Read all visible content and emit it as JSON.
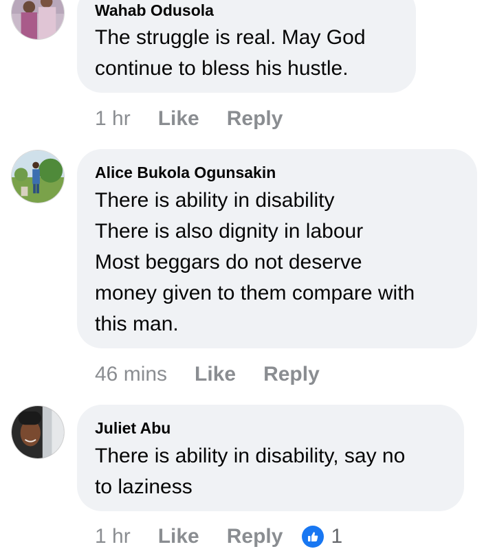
{
  "comments": [
    {
      "author": "Wahab Odusola",
      "text": "The struggle is real. May God\ncontinue to bless his hustle.",
      "time": "1 hr",
      "like_label": "Like",
      "reply_label": "Reply"
    },
    {
      "author": "Alice Bukola Ogunsakin",
      "text": "There is ability in disability\nThere is also dignity in labour\nMost beggars do not  deserve\nmoney given to them compare with\nthis man.",
      "time": "46 mins",
      "like_label": "Like",
      "reply_label": "Reply"
    },
    {
      "author": "Juliet Abu",
      "text": "There is ability in disability, say no\nto laziness",
      "time": "1 hr",
      "like_label": "Like",
      "reply_label": "Reply",
      "reaction_icon": "like-thumb-icon",
      "reaction_count": "1"
    }
  ],
  "colors": {
    "bubble": "#f0f2f5",
    "meta_text": "#8a8d91",
    "like_reaction": "#1877f2"
  }
}
